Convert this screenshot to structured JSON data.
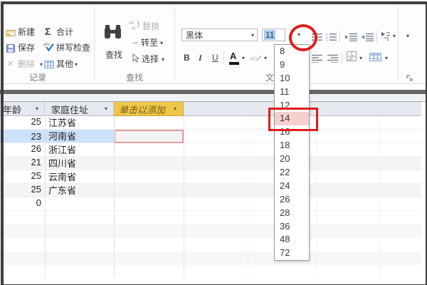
{
  "ribbon": {
    "records": {
      "group_label": "记录",
      "new_label": "新建",
      "save_label": "保存",
      "delete_label": "删除",
      "totals_label": "合计",
      "spelling_label": "拼写检查",
      "more_label": "其他"
    },
    "find": {
      "group_label": "查找",
      "find_label": "查找",
      "replace_label": "替换",
      "goto_label": "转至",
      "select_label": "选择"
    },
    "textformat": {
      "group_label_partial": "文",
      "font_name": "黑体",
      "font_size": "11"
    }
  },
  "glyphs": {
    "dropdown": "▾",
    "sum": "Σ",
    "delete_x": "✕",
    "bold": "B",
    "italic": "I",
    "underline": "U",
    "font_color": "A",
    "goto_arrow": "→"
  },
  "font_size_dropdown": {
    "selected_value": "11",
    "highlighted_value": "14",
    "options": [
      "8",
      "9",
      "10",
      "11",
      "12",
      "14",
      "16",
      "18",
      "20",
      "22",
      "24",
      "26",
      "28",
      "36",
      "48",
      "72"
    ]
  },
  "datasheet": {
    "columns": {
      "age": "年龄",
      "address": "家庭住址",
      "add": "单击以添加"
    },
    "rows": [
      {
        "age": "25",
        "address": "江苏省"
      },
      {
        "age": "23",
        "address": "河南省"
      },
      {
        "age": "26",
        "address": "浙江省"
      },
      {
        "age": "21",
        "address": "四川省"
      },
      {
        "age": "25",
        "address": "云南省"
      },
      {
        "age": "25",
        "address": "广东省"
      },
      {
        "age": "0",
        "address": ""
      }
    ],
    "selected_row_index": 1
  },
  "icons": [
    "new-record-icon",
    "save-icon",
    "delete-icon",
    "totals-sigma-icon",
    "spelling-check-icon",
    "more-table-icon",
    "binoculars-find-icon",
    "replace-icon",
    "goto-arrow-icon",
    "select-cursor-icon",
    "font-color-icon",
    "highlight-color-icon",
    "bullets-icon",
    "numbering-icon",
    "increase-indent-icon",
    "decrease-indent-icon",
    "text-direction-icon",
    "align-left-icon",
    "align-right-icon",
    "gridlines-icon",
    "alt-row-color-icon",
    "dialog-launcher-icon",
    "column-dropdown-icon"
  ],
  "colors": {
    "annotation_red": "#e01b1b",
    "selection_blue": "#cbe2fa",
    "header_gold": "#efc54a",
    "size_selection_blue": "#a6cdf5",
    "band_gray": "#666666"
  }
}
